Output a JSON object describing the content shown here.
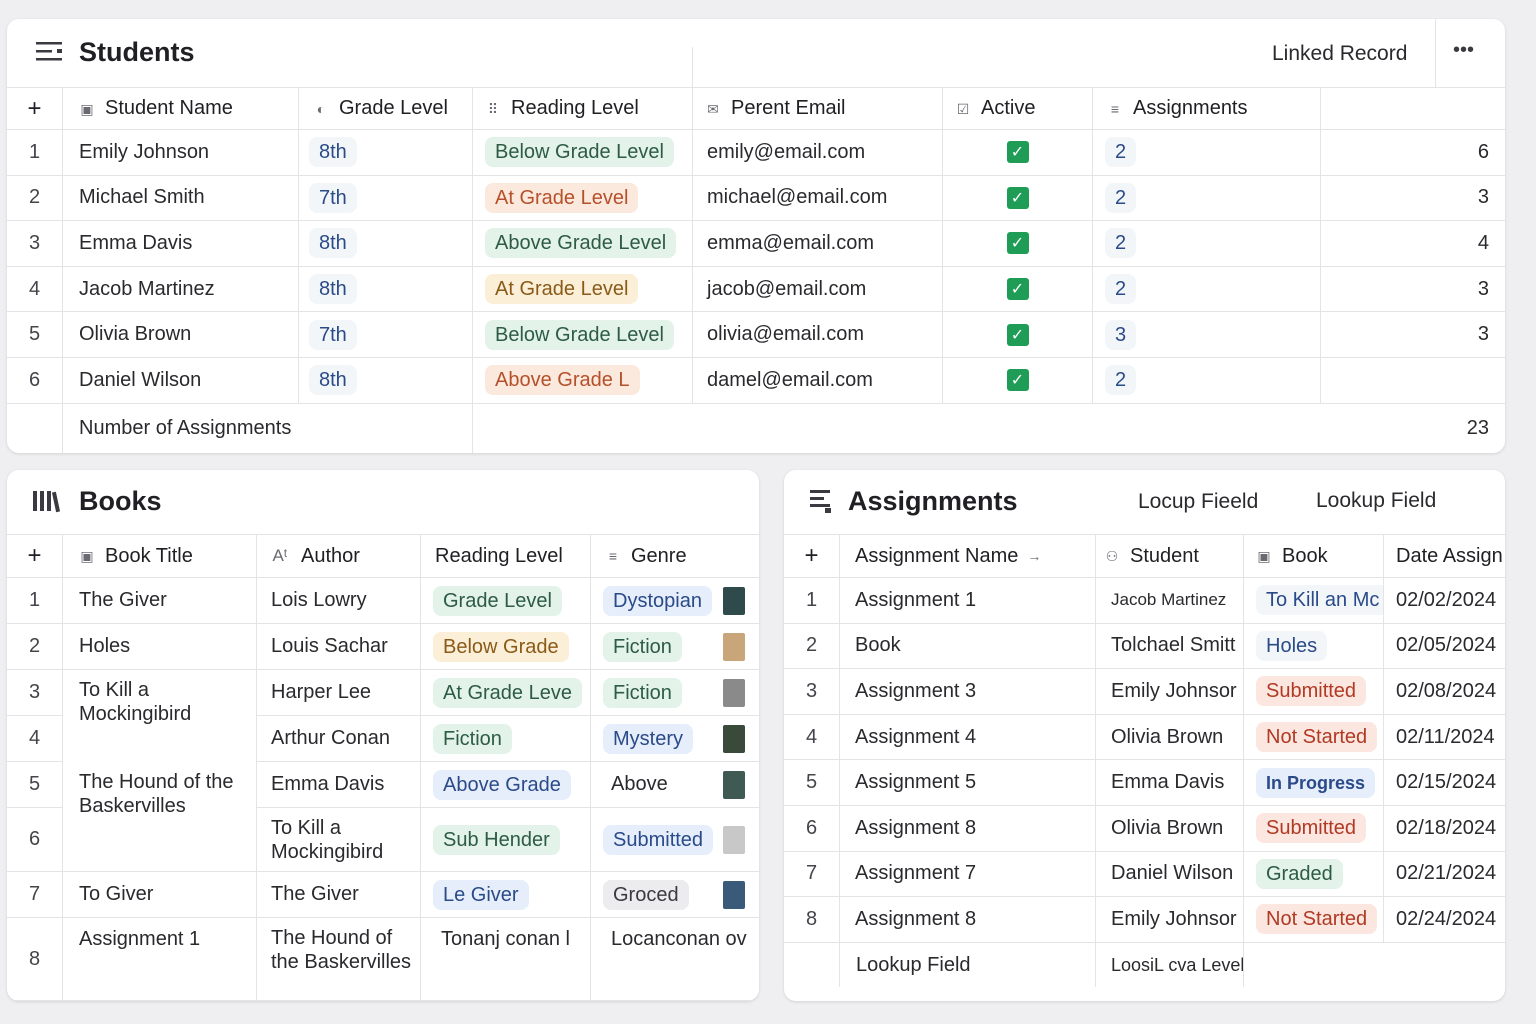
{
  "students": {
    "title": "Students",
    "linked_record": "Linked Record",
    "more": "•••",
    "add": "+",
    "columns": [
      "Student Name",
      "Grade Level",
      "Reading Level",
      "Perent Email",
      "Active",
      "Assignments"
    ],
    "rows": [
      {
        "n": "1",
        "name": "Emily Johnson",
        "grade": "8th",
        "reading": "Below Grade Level",
        "email": "emily@email.com",
        "assign": "2",
        "count": "6"
      },
      {
        "n": "2",
        "name": "Michael Smith",
        "grade": "7th",
        "reading": "At Grade Level",
        "email": "michael@email.com",
        "assign": "2",
        "count": "3"
      },
      {
        "n": "3",
        "name": "Emma Davis",
        "grade": "8th",
        "reading": "Above Grade Level",
        "email": "emma@email.com",
        "assign": "2",
        "count": "4"
      },
      {
        "n": "4",
        "name": "Jacob Martinez",
        "grade": "8th",
        "reading": "At Grade Level",
        "email": "jacob@email.com",
        "assign": "2",
        "count": "3"
      },
      {
        "n": "5",
        "name": "Olivia Brown",
        "grade": "7th",
        "reading": "Below Grade Level",
        "email": "olivia@email.com",
        "assign": "3",
        "count": "3"
      },
      {
        "n": "6",
        "name": "Daniel Wilson",
        "grade": "8th",
        "reading": "Above Grade L",
        "email": "damel@email.com",
        "assign": "2",
        "count": ""
      }
    ],
    "footer_label": "Number of Assignments",
    "footer_total": "23"
  },
  "books": {
    "title": "Books",
    "add": "+",
    "columns": [
      "Book Title",
      "Author",
      "Reading Level",
      "Genre"
    ],
    "rows": [
      {
        "n": "1",
        "title": "The Giver",
        "author": "Lois Lowry",
        "reading": "Grade Level",
        "genre": "Dystopian"
      },
      {
        "n": "2",
        "title": "Holes",
        "author": "Louis Sachar",
        "reading": "Below Grade",
        "genre": "Fiction"
      },
      {
        "n": "3",
        "title": "To Kill a Mockingibird",
        "author": "Harper Lee",
        "reading": "At Grade Leve",
        "genre": "Fiction"
      },
      {
        "n": "4",
        "title": "",
        "author": "Arthur Conan",
        "reading": "Fiction",
        "genre": "Mystery"
      },
      {
        "n": "5",
        "title": "The Hound of the Baskervilles",
        "author": "Emma Davis",
        "reading": "Above Grade",
        "genre": "Above"
      },
      {
        "n": "6",
        "title": "",
        "author": "To Kill a Mockingibird",
        "reading": "Sub Hender",
        "genre": "Submitted"
      },
      {
        "n": "7",
        "title": "To  Giver",
        "author": "The Giver",
        "reading": "Le Giver",
        "genre": "Groced"
      },
      {
        "n": "8",
        "title": "Assignment 1",
        "author": "The Hound of the Baskervilles",
        "reading": "Tonanj conan l",
        "genre": "Locanconan ov"
      }
    ]
  },
  "assignments": {
    "title": "Assignments",
    "lookup1": "Locup Fieeld",
    "lookup2": "Lookup Field",
    "add": "+",
    "columns": [
      "Assignment Name",
      "Student",
      "Book",
      "Date Assign"
    ],
    "rows": [
      {
        "n": "1",
        "name": "Assignment 1",
        "student": "Jacob Martinez",
        "book": "To Kill an Mc",
        "date": "02/02/2024"
      },
      {
        "n": "2",
        "name": "Book",
        "student": "Tolchael Smitt",
        "book": "Holes",
        "date": "02/05/2024"
      },
      {
        "n": "3",
        "name": "Assignment 3",
        "student": "Emily Johnsor",
        "book": "Submitted",
        "date": "02/08/2024"
      },
      {
        "n": "4",
        "name": "Assignment 4",
        "student": "Olivia Brown",
        "book": "Not Started",
        "date": "02/11/2024"
      },
      {
        "n": "5",
        "name": "Assignment 5",
        "student": "Emma Davis",
        "book": "In Progress",
        "date": "02/15/2024"
      },
      {
        "n": "6",
        "name": "Assignment 8",
        "student": "Olivia Brown",
        "book": "Submitted",
        "date": "02/18/2024"
      },
      {
        "n": "7",
        "name": "Assignment 7",
        "student": "Daniel Wilson",
        "book": "Graded",
        "date": "02/21/2024"
      },
      {
        "n": "8",
        "name": "Assignment 8",
        "student": "Emily Johnsor",
        "book": "Not Started",
        "date": "02/24/2024"
      }
    ],
    "footer_name": "Lookup Field",
    "footer_student": "LoosiL cva Level"
  }
}
